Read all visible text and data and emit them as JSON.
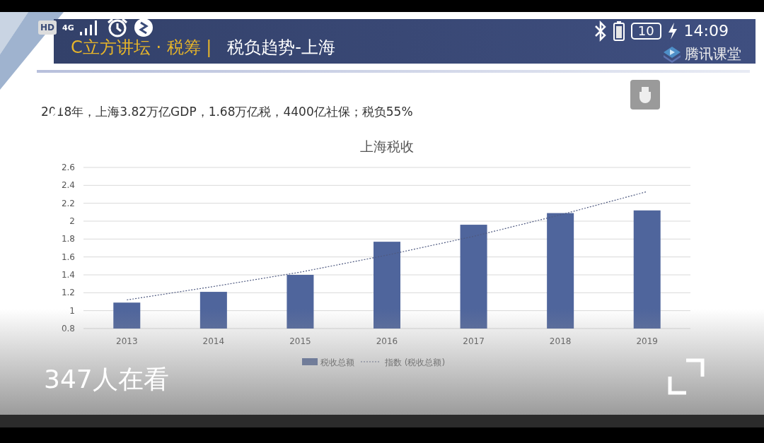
{
  "status_bar": {
    "hd": "HD",
    "network": "4G",
    "battery": "10",
    "time": "14:09"
  },
  "slide": {
    "brand": "C立方讲坛 · 税筹 |",
    "title": "税负趋势-上海",
    "logo_text": "腾讯课堂",
    "summary": "2018年，上海3.82万亿GDP，1.68万亿税，4400亿社保；税负55%",
    "chart_data": {
      "type": "bar",
      "title": "上海税收",
      "grid": true,
      "legend": "bottom",
      "categories": [
        "2013",
        "2014",
        "2015",
        "2016",
        "2017",
        "2018",
        "2019"
      ],
      "ylim": [
        0.8,
        2.6
      ],
      "yticks": [
        {
          "value": 0.8,
          "label": "0.8"
        },
        {
          "value": 1,
          "label": "1"
        },
        {
          "value": 1.2,
          "label": "1.2"
        },
        {
          "value": 1.4,
          "label": "1.4"
        },
        {
          "value": 1.6,
          "label": "1.6"
        },
        {
          "value": 1.8,
          "label": "1.8"
        },
        {
          "value": 2,
          "label": "2"
        },
        {
          "value": 2.2,
          "label": "2.2"
        },
        {
          "value": 2.4,
          "label": "2.4"
        },
        {
          "value": 2.6,
          "label": "2.6"
        }
      ],
      "series": [
        {
          "name": "税收总额",
          "type": "bar",
          "color": "#4f659c",
          "values": [
            1.09,
            1.21,
            1.4,
            1.77,
            1.96,
            2.09,
            2.12
          ]
        },
        {
          "name": "指数 (税收总额)",
          "type": "line",
          "line_style": "dashed",
          "color": "#4f5a80",
          "values": [
            1.12,
            1.27,
            1.43,
            1.62,
            1.83,
            2.07,
            2.33
          ]
        }
      ]
    }
  },
  "viewers": "347人在看"
}
